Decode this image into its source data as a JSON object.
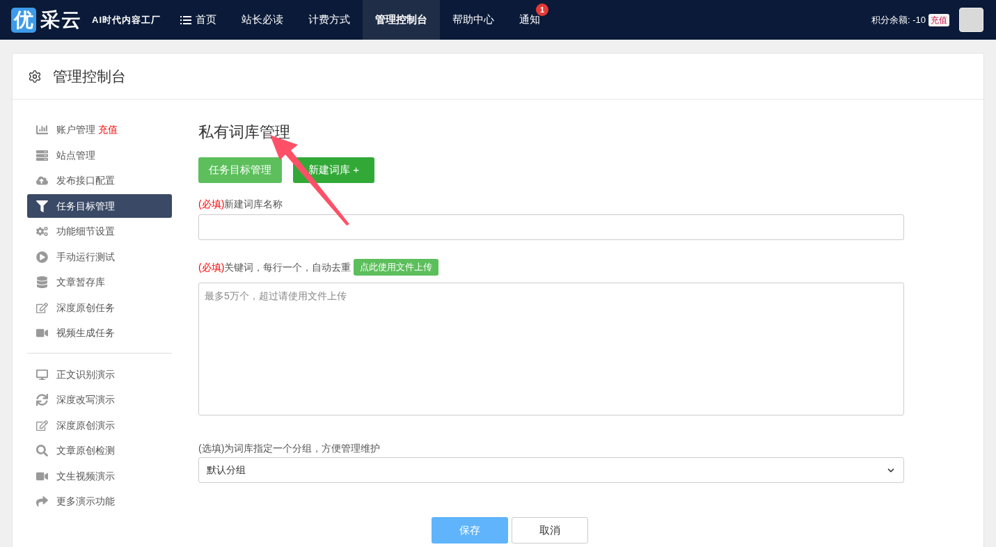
{
  "topbar": {
    "logo": {
      "mark": "优",
      "name": "采云",
      "tagline": "AI时代内容工厂"
    },
    "nav": [
      {
        "label": "首页",
        "selected": false,
        "kind": "menu"
      },
      {
        "label": "站长必读",
        "selected": false,
        "kind": "plain"
      },
      {
        "label": "计费方式",
        "selected": false,
        "kind": "plain"
      },
      {
        "label": "管理控制台",
        "selected": true,
        "kind": "plain"
      },
      {
        "label": "帮助中心",
        "selected": false,
        "kind": "plain"
      },
      {
        "label": "通知",
        "selected": false,
        "kind": "plain",
        "badge": "1"
      }
    ],
    "balance": "积分余额: -10",
    "recharge": "充值"
  },
  "panel": {
    "title": "管理控制台"
  },
  "sidebar": {
    "groups": [
      {
        "items": [
          {
            "label": "账户管理",
            "badge": "充值",
            "selected": false
          },
          {
            "label": "站点管理",
            "selected": false
          },
          {
            "label": "发布接口配置",
            "selected": false
          },
          {
            "label": "任务目标管理",
            "selected": true
          },
          {
            "label": "功能细节设置",
            "selected": false
          },
          {
            "label": "手动运行测试",
            "selected": false
          },
          {
            "label": "文章暂存库",
            "selected": false
          },
          {
            "label": "深度原创任务",
            "selected": false
          },
          {
            "label": "视频生成任务",
            "selected": false
          }
        ]
      },
      {
        "items": [
          {
            "label": "正文识别演示",
            "selected": false
          },
          {
            "label": "深度改写演示",
            "selected": false
          },
          {
            "label": "深度原创演示",
            "selected": false
          },
          {
            "label": "文章原创检测",
            "selected": false
          },
          {
            "label": "文生视频演示",
            "selected": false
          },
          {
            "label": "更多演示功能",
            "selected": false
          }
        ]
      }
    ]
  },
  "content": {
    "title": "私有词库管理",
    "tabs": [
      {
        "label": "任务目标管理",
        "selected": false
      },
      {
        "label": "新建词库 +",
        "selected": true
      }
    ],
    "fields": [
      {
        "kind": "input",
        "prefix": "(必填)",
        "required": true,
        "label": "新建词库名称"
      },
      {
        "kind": "textarea",
        "prefix": "(必填)",
        "required": true,
        "label": "关键词，每行一个，自动去重",
        "action": "点此使用文件上传",
        "placeholder": "最多5万个，超过请使用文件上传"
      },
      {
        "kind": "select",
        "prefix": "(选填)",
        "required": false,
        "label": "为词库指定一个分组，方便管理维护",
        "value": "默认分组"
      }
    ],
    "buttons": [
      {
        "label": "保存",
        "kind": "primary"
      },
      {
        "label": "取消",
        "kind": "default"
      }
    ]
  }
}
